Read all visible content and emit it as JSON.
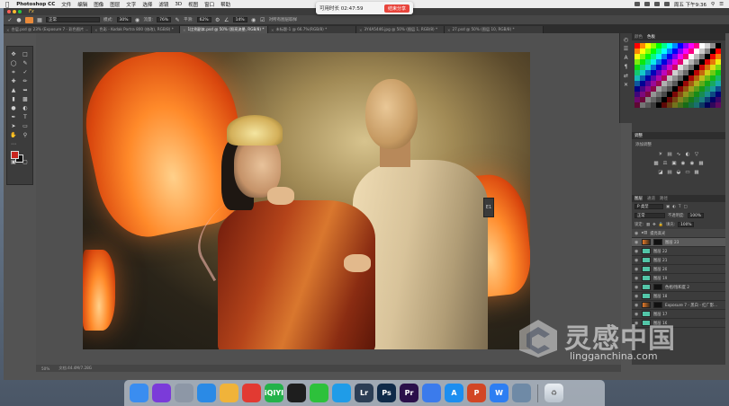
{
  "menubar": {
    "app_name": "Photoshop CC",
    "items": [
      "文件",
      "编辑",
      "图像",
      "图层",
      "文字",
      "选择",
      "滤镜",
      "3D",
      "视图",
      "窗口",
      "帮助"
    ],
    "clock": "周五 下午9:36"
  },
  "timer": {
    "label": "可用时长 02:47:59",
    "stop_label": "结束分享"
  },
  "titlebar": {
    "effect_label": "Fx"
  },
  "options": {
    "mode_value": "正常",
    "opacity_label": "模式:",
    "opacity_value": "30%",
    "flow_label": "流量:",
    "flow_value": "76%",
    "smooth_label": "平滑:",
    "smooth_value": "62%",
    "angle_label": "",
    "angle_value": "14%",
    "pressure_label": "对所有图层取样"
  },
  "tabs": [
    {
      "label": "合层.psd @ 23% (Exposure 7 - 彩色图片 ...",
      "active": false
    },
    {
      "label": "色彩 - Kodak Portra 800 (修改), RGB/8) *",
      "active": false
    },
    {
      "label": "1比例副本.psd @ 50% (照亮流晕, RGB/8) *",
      "active": true
    },
    {
      "label": "未标题-1 @ 66.7%(RGB/8) *",
      "active": false
    },
    {
      "label": "3Y4A5446.jpg @ 50% (图层 1, RGB/8) *",
      "active": false
    },
    {
      "label": "27.psd @ 50% (图层 10, RGB/8) *",
      "active": false
    }
  ],
  "status": {
    "zoom": "50%",
    "doc": "文档:44.4M/7.28G"
  },
  "panels": {
    "swatch_tabs": [
      "颜色",
      "色板"
    ],
    "adjustments_tabs": [
      "调整"
    ],
    "adjustments_title": "添加调整",
    "layers_tabs": [
      "图层",
      "通道",
      "路径"
    ],
    "layers_filter": "P 类型",
    "blend_mode": "正常",
    "opacity_label": "不透明度:",
    "opacity_value": "100%",
    "lock_label": "锁定:",
    "fill_label": "填充:",
    "fill_value": "100%",
    "layers": [
      {
        "name": "提亮高光",
        "kind": "group"
      },
      {
        "name": "图层 23",
        "kind": "photo"
      },
      {
        "name": "图层 22",
        "kind": "plain"
      },
      {
        "name": "图层 21",
        "kind": "plain"
      },
      {
        "name": "图层 20",
        "kind": "plain"
      },
      {
        "name": "图层 19",
        "kind": "plain"
      },
      {
        "name": "色相/饱和度 2",
        "kind": "adjust"
      },
      {
        "name": "图层 18",
        "kind": "plain"
      },
      {
        "name": "Exposure 7 - 黑白 - 红广影...",
        "kind": "photo"
      },
      {
        "name": "图层 17",
        "kind": "plain"
      },
      {
        "name": "图层 16",
        "kind": "plain"
      }
    ]
  },
  "mini_float": {
    "label": "E1"
  },
  "watermark": {
    "cn": "灵感中国",
    "url": "lingganchina.com"
  },
  "dock": {
    "apps": [
      {
        "name": "finder",
        "label": "",
        "color": "#3a8df0"
      },
      {
        "name": "siri",
        "label": "",
        "color": "#7b3bd9"
      },
      {
        "name": "launchpad",
        "label": "",
        "color": "#8d97a6"
      },
      {
        "name": "safari",
        "label": "",
        "color": "#2a8ae6"
      },
      {
        "name": "photos",
        "label": "",
        "color": "#f0b33a"
      },
      {
        "name": "netease-music",
        "label": "",
        "color": "#e23a32"
      },
      {
        "name": "iqiyi",
        "label": "iQIYI",
        "color": "#23b24a"
      },
      {
        "name": "qq",
        "label": "",
        "color": "#1e1e1e"
      },
      {
        "name": "wechat",
        "label": "",
        "color": "#2dc13b"
      },
      {
        "name": "tencent-video",
        "label": "",
        "color": "#1f9ce8"
      },
      {
        "name": "lightroom",
        "label": "Lr",
        "color": "#2c3e55"
      },
      {
        "name": "photoshop",
        "label": "Ps",
        "color": "#0f2a49"
      },
      {
        "name": "premiere",
        "label": "Pr",
        "color": "#2a0f4a"
      },
      {
        "name": "baidu-netdisk",
        "label": "",
        "color": "#3b7bec"
      },
      {
        "name": "app-store",
        "label": "A",
        "color": "#1c8ef0"
      },
      {
        "name": "powerpoint",
        "label": "P",
        "color": "#d24625"
      },
      {
        "name": "wps",
        "label": "W",
        "color": "#2d7ef2"
      },
      {
        "name": "preview",
        "label": "",
        "color": "#6f8aa6"
      }
    ],
    "trash_label": ""
  }
}
